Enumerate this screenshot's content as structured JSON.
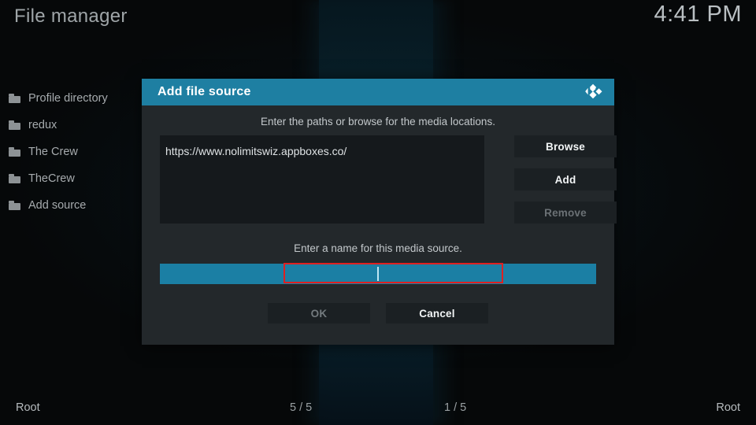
{
  "window": {
    "title": "File manager",
    "clock": "4:41 PM"
  },
  "sidebar": {
    "items": [
      {
        "icon": "folder-icon",
        "label": "Profile directory"
      },
      {
        "icon": "folder-icon",
        "label": "redux"
      },
      {
        "icon": "folder-icon",
        "label": "The Crew"
      },
      {
        "icon": "folder-icon",
        "label": "TheCrew"
      },
      {
        "icon": "folder-icon",
        "label": "Add source"
      }
    ]
  },
  "dialog": {
    "title": "Add file source",
    "logo_icon": "kodi-logo-icon",
    "hint_paths": "Enter the paths or browse for the media locations.",
    "hint_name": "Enter a name for this media source.",
    "path_entries": [
      "https://www.nolimitswiz.appboxes.co/"
    ],
    "buttons": {
      "browse": "Browse",
      "add": "Add",
      "remove": "Remove",
      "ok": "OK",
      "cancel": "Cancel"
    },
    "name_field": {
      "value": "",
      "focused": true,
      "caret_visible": true
    }
  },
  "bottom_bar": {
    "left_label": "Root",
    "left_count": "5 / 5",
    "right_count": "1 / 5",
    "right_label": "Root"
  },
  "colors": {
    "accent_teal": "#1e7fa2",
    "input_teal": "#1b7fa4",
    "dialog_bg": "#23282b",
    "panel_bg": "#15191c",
    "button_bg": "#1b2023",
    "highlight_red": "#e02020",
    "text_primary": "#e6e6e6",
    "text_muted": "#737a7e"
  }
}
